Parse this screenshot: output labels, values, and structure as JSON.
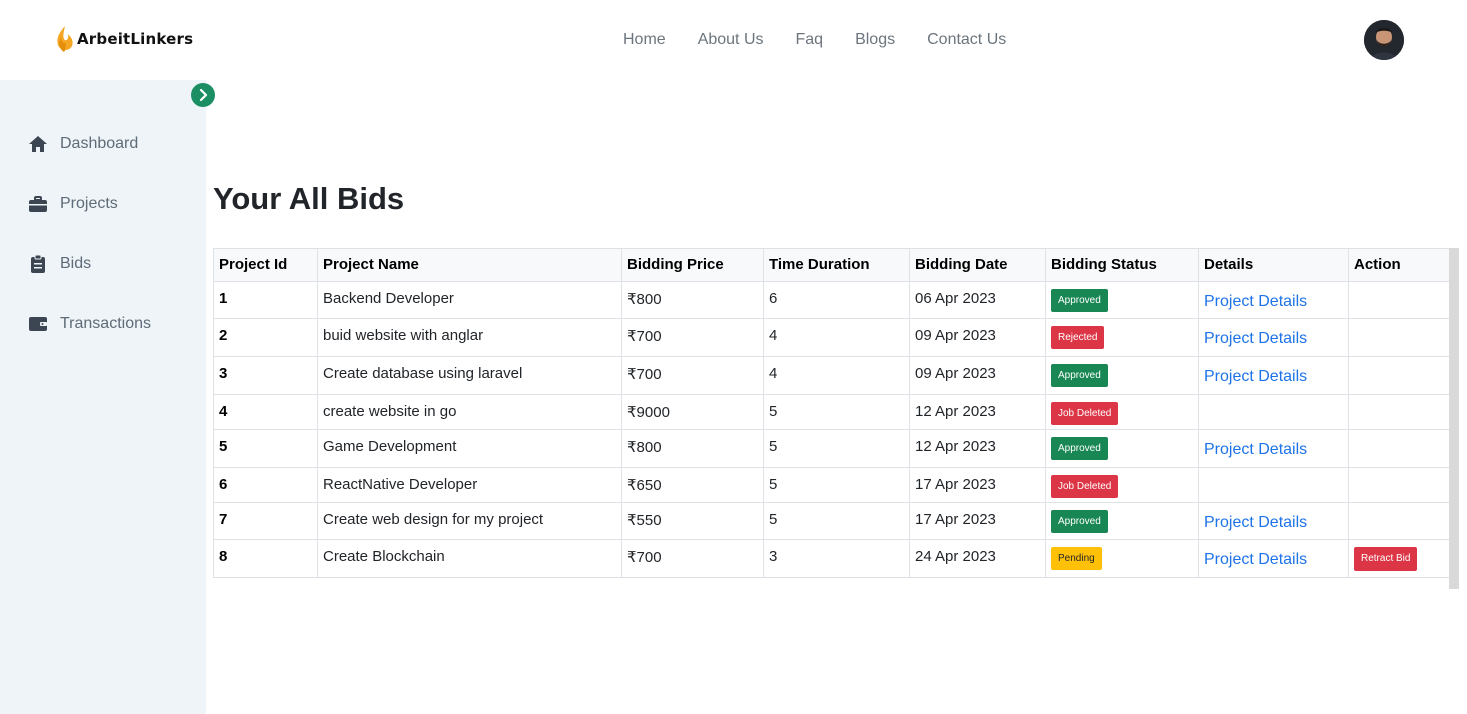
{
  "brand": {
    "name": "ArbeitLinkers"
  },
  "nav": {
    "links": [
      "Home",
      "About Us",
      "Faq",
      "Blogs",
      "Contact Us"
    ]
  },
  "sidebar": {
    "items": [
      {
        "label": "Dashboard",
        "icon": "home-icon"
      },
      {
        "label": "Projects",
        "icon": "briefcase-icon"
      },
      {
        "label": "Bids",
        "icon": "clipboard-icon"
      },
      {
        "label": "Transactions",
        "icon": "wallet-icon"
      }
    ]
  },
  "main": {
    "title": "Your All Bids",
    "columns": [
      "Project Id",
      "Project Name",
      "Bidding Price",
      "Time Duration",
      "Bidding Date",
      "Bidding Status",
      "Details",
      "Action"
    ],
    "rows": [
      {
        "id": "1",
        "name": "Backend Developer",
        "price": "₹800",
        "duration": "6",
        "date": "06 Apr 2023",
        "status": "Approved",
        "details": "Project Details",
        "action": ""
      },
      {
        "id": "2",
        "name": "buid website with anglar",
        "price": "₹700",
        "duration": "4",
        "date": "09 Apr 2023",
        "status": "Rejected",
        "details": "Project Details",
        "action": ""
      },
      {
        "id": "3",
        "name": "Create database using laravel",
        "price": "₹700",
        "duration": "4",
        "date": "09 Apr 2023",
        "status": "Approved",
        "details": "Project Details",
        "action": ""
      },
      {
        "id": "4",
        "name": "create website in go",
        "price": "₹9000",
        "duration": "5",
        "date": "12 Apr 2023",
        "status": "Job Deleted",
        "details": "",
        "action": ""
      },
      {
        "id": "5",
        "name": "Game Development",
        "price": "₹800",
        "duration": "5",
        "date": "12 Apr 2023",
        "status": "Approved",
        "details": "Project Details",
        "action": ""
      },
      {
        "id": "6",
        "name": "ReactNative Developer",
        "price": "₹650",
        "duration": "5",
        "date": "17 Apr 2023",
        "status": "Job Deleted",
        "details": "",
        "action": ""
      },
      {
        "id": "7",
        "name": "Create web design for my project",
        "price": "₹550",
        "duration": "5",
        "date": "17 Apr 2023",
        "status": "Approved",
        "details": "Project Details",
        "action": ""
      },
      {
        "id": "8",
        "name": "Create Blockchain",
        "price": "₹700",
        "duration": "3",
        "date": "24 Apr 2023",
        "status": "Pending",
        "details": "Project Details",
        "action": "Retract Bid"
      }
    ]
  },
  "colors": {
    "approved": "#198754",
    "rejected": "#dc3545",
    "deleted": "#dc3545",
    "pending": "#ffc107",
    "link": "#1e73e8",
    "toggle": "#1b8f63",
    "sidebar_bg": "#eef4f7"
  }
}
